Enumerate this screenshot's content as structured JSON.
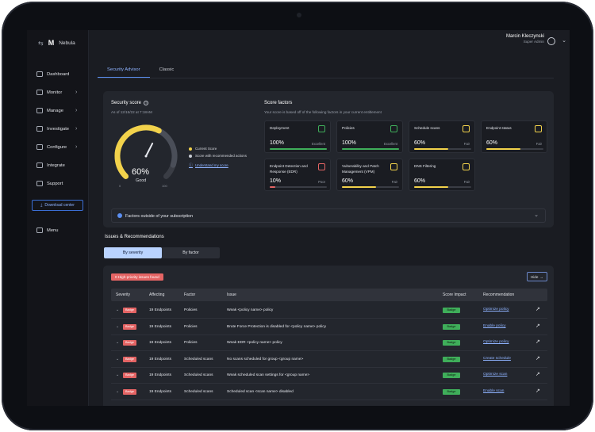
{
  "app": {
    "name": "Nebula",
    "logo": "M"
  },
  "user": {
    "name": "Marcin Kleczynski",
    "role": "Super Admin"
  },
  "sidebar": {
    "items": [
      {
        "label": "Dashboard",
        "chevron": ""
      },
      {
        "label": "Monitor",
        "chevron": "›"
      },
      {
        "label": "Manage",
        "chevron": "›"
      },
      {
        "label": "Investigate",
        "chevron": "›"
      },
      {
        "label": "Configure",
        "chevron": "›"
      },
      {
        "label": "Integrate",
        "chevron": ""
      },
      {
        "label": "Support",
        "chevron": ""
      }
    ],
    "download_label": "Download center",
    "menu_label": "Menu"
  },
  "tabs": {
    "security_advisor": "Security Advisor",
    "classic": "Classic"
  },
  "security_score": {
    "title": "Security score",
    "as_of": "As of 12/15/22 at 7:18AM",
    "score_text": "60%",
    "score_fraction": 0.6,
    "recommended_fraction": 0.9,
    "rating": "Good",
    "min": "0",
    "max": "100",
    "legend_current": "Current Score",
    "legend_recommended": "Score with recommended actions",
    "understand_link": "Understand my score"
  },
  "score_factors": {
    "title": "Score factors",
    "subtitle": "Your score is based off of the following factors in your current entitlement",
    "cards": [
      {
        "name": "Deployment",
        "value": "100%",
        "fraction": 1.0,
        "status": "Excellent",
        "color": "#3fae5a"
      },
      {
        "name": "Policies",
        "value": "100%",
        "fraction": 1.0,
        "status": "Excellent",
        "color": "#3fae5a"
      },
      {
        "name": "Schedule scans",
        "value": "60%",
        "fraction": 0.6,
        "status": "Fair",
        "color": "#f2d24b"
      },
      {
        "name": "Endpoint status",
        "value": "60%",
        "fraction": 0.6,
        "status": "Fair",
        "color": "#f2d24b"
      },
      {
        "name": "Endpoint Detection and Response (EDR)",
        "value": "10%",
        "fraction": 0.1,
        "status": "Poor",
        "color": "#e46464"
      },
      {
        "name": "Vulnerability and Patch Management (VPM)",
        "value": "60%",
        "fraction": 0.6,
        "status": "Fair",
        "color": "#f2d24b"
      },
      {
        "name": "DNS Filtering",
        "value": "60%",
        "fraction": 0.6,
        "status": "Fair",
        "color": "#f2d24b"
      }
    ],
    "outside_label": "Factors outside of your subscription"
  },
  "issues": {
    "title": "Issues & Recommendations",
    "toggle": {
      "by_severity": "By severity",
      "by_factor": "By factor"
    },
    "high_priority_badge": "0 High-priority issues found",
    "hide_label": "Hide",
    "columns": {
      "severity": "Severity",
      "affecting": "Affecting",
      "factor": "Factor",
      "issue": "Issue",
      "score_impact": "Score Impact",
      "recommendation": "Recommendation"
    },
    "rows": [
      {
        "severity": "Badge",
        "affecting": "19 Endpoints",
        "factor": "Policies",
        "issue": "Weak <policy name> policy",
        "impact": "Badge",
        "recommendation": "Optimize policy"
      },
      {
        "severity": "Badge",
        "affecting": "19 Endpoints",
        "factor": "Policies",
        "issue": "Brute Force Protection is disabled for <policy name> policy",
        "impact": "Badge",
        "recommendation": "Enable policy"
      },
      {
        "severity": "Badge",
        "affecting": "19 Endpoints",
        "factor": "Policies",
        "issue": "Weak EDR <policy name> policy",
        "impact": "Badge",
        "recommendation": "Optimize policy"
      },
      {
        "severity": "Badge",
        "affecting": "19 Endpoints",
        "factor": "Scheduled scans",
        "issue": "No scans scheduled for group <group name>",
        "impact": "Badge",
        "recommendation": "Create schedule"
      },
      {
        "severity": "Badge",
        "affecting": "19 Endpoints",
        "factor": "Scheduled scans",
        "issue": "Weak scheduled scan settings for <group name>",
        "impact": "Badge",
        "recommendation": "Optimize scan"
      },
      {
        "severity": "Badge",
        "affecting": "19 Endpoints",
        "factor": "Scheduled scans",
        "issue": "Scheduled scan <scan name> disabled",
        "impact": "Badge",
        "recommendation": "Enable scan"
      }
    ]
  },
  "icons": {
    "collapse": "⇆",
    "info": "i",
    "chevron_down": "⌄",
    "chevron_right": "›",
    "external": "↗",
    "arrow": "→"
  },
  "colors": {
    "accent": "#5b8ef0",
    "good": "#3fae5a",
    "fair": "#f2d24b",
    "poor": "#e46464",
    "gauge_track": "#3a3d45"
  }
}
